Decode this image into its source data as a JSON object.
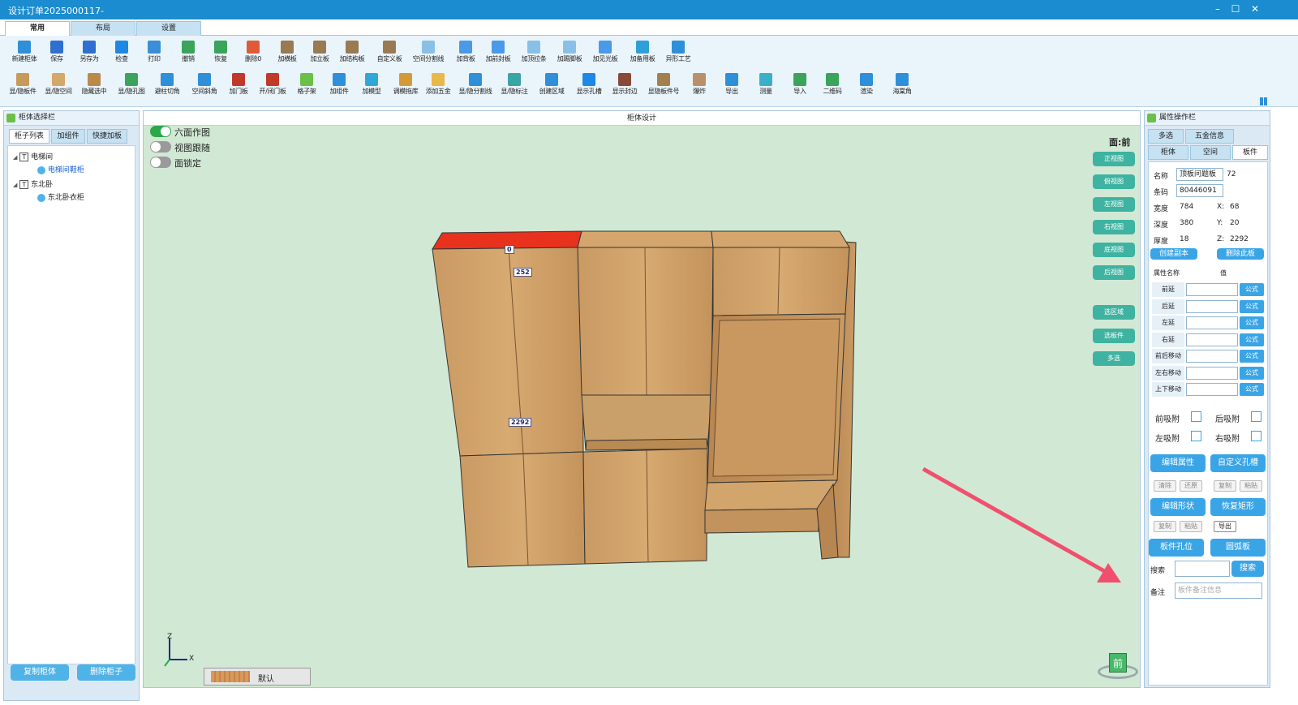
{
  "window": {
    "title": "设计订单2025000117-",
    "controls": [
      "–",
      "☐",
      "✕"
    ]
  },
  "main_tabs": [
    "常用",
    "布局",
    "设置"
  ],
  "ribbon_row1": [
    {
      "label": "新建柜体",
      "color": "#2f8fd8"
    },
    {
      "label": "保存",
      "color": "#2f6fd0"
    },
    {
      "label": "另存为",
      "color": "#2f6fd0"
    },
    {
      "label": "检查",
      "color": "#1e88e5"
    },
    {
      "label": "打印",
      "color": "#3a8fd8"
    },
    {
      "label": "撤销",
      "color": "#3aa55a"
    },
    {
      "label": "恢复",
      "color": "#3aa55a"
    },
    {
      "label": "删除0",
      "color": "#e05a3a"
    },
    {
      "label": "加横板",
      "color": "#9a7a52"
    },
    {
      "label": "加立板",
      "color": "#9a7a52"
    },
    {
      "label": "加结构板",
      "color": "#9a7a52"
    },
    {
      "label": "自定义板",
      "color": "#9a7a52"
    },
    {
      "label": "空间分割线",
      "color": "#8ac0e8"
    },
    {
      "label": "加背板",
      "color": "#4a9ae8"
    },
    {
      "label": "加前封板",
      "color": "#4a9ae8"
    },
    {
      "label": "加顶拉条",
      "color": "#8ac0e8"
    },
    {
      "label": "加踢脚板",
      "color": "#8ac0e8"
    },
    {
      "label": "加见光板",
      "color": "#4a9ae8"
    },
    {
      "label": "加备用板",
      "color": "#2f9fd8"
    },
    {
      "label": "异形工艺",
      "color": "#2f8fd8"
    }
  ],
  "ribbon_row2": [
    {
      "label": "显/隐板件",
      "color": "#c69a5a"
    },
    {
      "label": "显/隐空间",
      "color": "#d4a868"
    },
    {
      "label": "隐藏选中",
      "color": "#b98a4a"
    },
    {
      "label": "显/隐孔图",
      "color": "#3aa55a"
    },
    {
      "label": "避柱切角",
      "color": "#2f8fd8"
    },
    {
      "label": "空间斜角",
      "color": "#2f8fd8"
    },
    {
      "label": "加门板",
      "color": "#c0392b"
    },
    {
      "label": "开/闭门板",
      "color": "#c0392b"
    },
    {
      "label": "格子架",
      "color": "#6cc04a"
    },
    {
      "label": "加组件",
      "color": "#2f8fd8"
    },
    {
      "label": "加模型",
      "color": "#2fa8d8"
    },
    {
      "label": "调模拖库",
      "color": "#d49a3a"
    },
    {
      "label": "添加五金",
      "color": "#e8b84a"
    },
    {
      "label": "显/隐分割线",
      "color": "#2f8fd8"
    },
    {
      "label": "显/隐标注",
      "color": "#3aa5a5"
    },
    {
      "label": "创建区域",
      "color": "#2f8fd8"
    },
    {
      "label": "显示孔槽",
      "color": "#1e88e5"
    },
    {
      "label": "显示封边",
      "color": "#8a4a3a"
    },
    {
      "label": "显隐板件号",
      "color": "#a08050"
    },
    {
      "label": "爆炸",
      "color": "#b9906a"
    },
    {
      "label": "导出",
      "color": "#2f8fd8"
    },
    {
      "label": "测量",
      "color": "#3ab0c8"
    },
    {
      "label": "导入",
      "color": "#3aa55a"
    },
    {
      "label": "二维码",
      "color": "#3aa55a"
    },
    {
      "label": "渲染",
      "color": "#2f8fd8"
    },
    {
      "label": "海棠角",
      "color": "#2f8fd8"
    }
  ],
  "left_panel": {
    "title": "柜体选择栏",
    "tabs": [
      "柜子列表",
      "加组件",
      "快捷加板"
    ],
    "tree": {
      "root1": "电梯间",
      "child1": "电梯间鞋柜",
      "root2": "东北卧",
      "child2": "东北卧衣柜"
    },
    "buttons": [
      "复制柜体",
      "删除柜子"
    ]
  },
  "center": {
    "title": "柜体设计",
    "toggles": [
      {
        "label": "六面作图",
        "on": true
      },
      {
        "label": "视图跟随",
        "on": false
      },
      {
        "label": "面锁定",
        "on": false
      }
    ],
    "face_label": "面:前",
    "view_buttons": [
      "正视图",
      "俯视图",
      "左视图",
      "右视图",
      "底视图",
      "后视图"
    ],
    "select_buttons": [
      "选区域",
      "选板件",
      "多选"
    ],
    "dims": {
      "width": "252",
      "height": "2292",
      "marker": "0"
    },
    "axes": {
      "z": "Z",
      "x": "X"
    },
    "material": "默认",
    "nav_cube": "前"
  },
  "right_panel": {
    "title": "属性操作栏",
    "tabs_row1": [
      "多选",
      "五金信息"
    ],
    "tabs_row2": [
      "柜体",
      "空间",
      "板件"
    ],
    "fields": {
      "name_label": "名称",
      "name_value": "顶板问题板",
      "name_extra": "72",
      "code_label": "条码",
      "code_value": "80446091",
      "width_label": "宽度",
      "width_value": "784",
      "x_label": "X:",
      "x_value": "68",
      "depth_label": "深度",
      "depth_value": "380",
      "y_label": "Y:",
      "y_value": "20",
      "thick_label": "厚度",
      "thick_value": "18",
      "z_label": "Z:",
      "z_value": "2292"
    },
    "copy_btn": "创建副本",
    "delete_btn": "删除此板",
    "prop_header_name": "属性名称",
    "prop_header_value": "值",
    "props": [
      "前延",
      "后延",
      "左延",
      "右延",
      "前后移动",
      "左右移动",
      "上下移动"
    ],
    "formula_label": "公式",
    "snap": {
      "front": "前吸附",
      "back": "后吸附",
      "left": "左吸附",
      "right": "右吸附"
    },
    "edit_props": "编辑属性",
    "custom_holes": "自定义孔槽",
    "small1": [
      "清除",
      "还原",
      "复制",
      "粘贴"
    ],
    "edit_shape": "编辑形状",
    "restore_rect": "恢复矩形",
    "small2": [
      "复制",
      "粘贴",
      "导出"
    ],
    "board_holes": "板件孔位",
    "arc_board": "圆弧板",
    "search_label": "搜索",
    "search_btn": "搜索",
    "note_label": "备注",
    "note_placeholder": "板件备注信息"
  }
}
